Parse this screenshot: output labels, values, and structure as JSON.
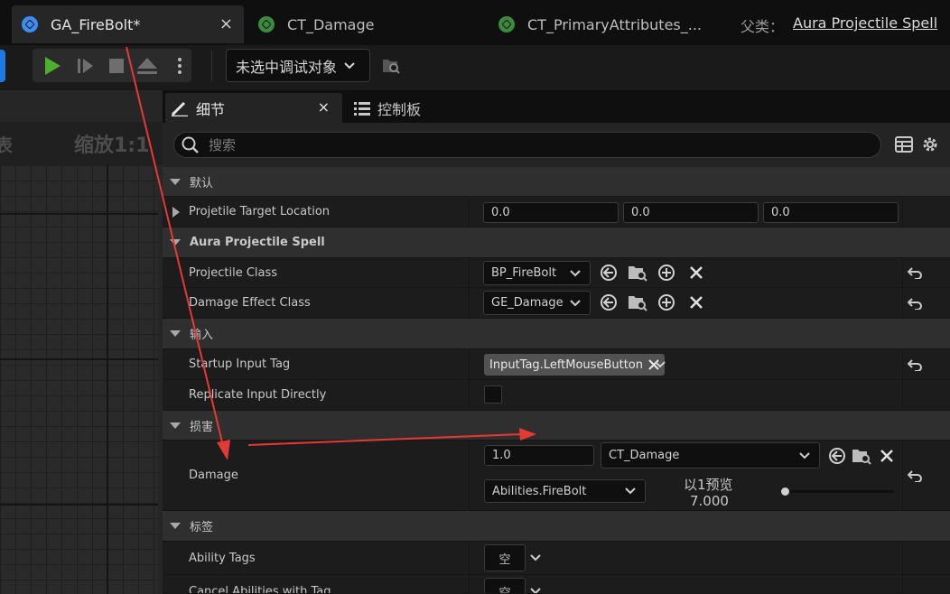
{
  "tabs": [
    {
      "label": "GA_FireBolt*",
      "icon": "blueprint-icon",
      "active": true
    },
    {
      "label": "CT_Damage",
      "icon": "curve-table-icon"
    },
    {
      "label": "CT_PrimaryAttributes_...",
      "icon": "curve-table-icon"
    }
  ],
  "tab_close": "×",
  "parent": {
    "label": "父类：",
    "value": "Aura Projectile Spell"
  },
  "toolbar": {
    "debug_select": "未选中调试对象"
  },
  "graph": {
    "zoom": "缩放1:1",
    "left_text": "表"
  },
  "panel_tabs": {
    "details": "细节",
    "console": "控制板",
    "close": "×"
  },
  "search": {
    "placeholder": "搜索"
  },
  "categories": {
    "default": "默认",
    "aura": "Aura Projectile Spell",
    "input": "输入",
    "damage": "损害",
    "tags": "标签"
  },
  "props": {
    "target_location": {
      "name": "Projetile Target Location",
      "values": [
        "0.0",
        "0.0",
        "0.0"
      ]
    },
    "projectile_class": {
      "name": "Projectile Class",
      "value": "BP_FireBolt"
    },
    "damage_effect_class": {
      "name": "Damage Effect Class",
      "value": "GE_Damage"
    },
    "startup_input_tag": {
      "name": "Startup Input Tag",
      "value": "InputTag.LeftMouseButton"
    },
    "replicate_input": {
      "name": "Replicate Input Directly"
    },
    "damage": {
      "name": "Damage",
      "value": "1.0",
      "table": "CT_Damage",
      "row": "Abilities.FireBolt",
      "preview_label": "以1预览",
      "preview_value": "7.000"
    },
    "ability_tags": {
      "name": "Ability Tags",
      "value": "空"
    },
    "cancel_abilities": {
      "name": "Cancel Abilities with Tag",
      "value": "空"
    }
  },
  "colors": {
    "accent_blue": "#3b8df0",
    "play_green": "#4caf2e",
    "annotation_red": "#e53935"
  }
}
